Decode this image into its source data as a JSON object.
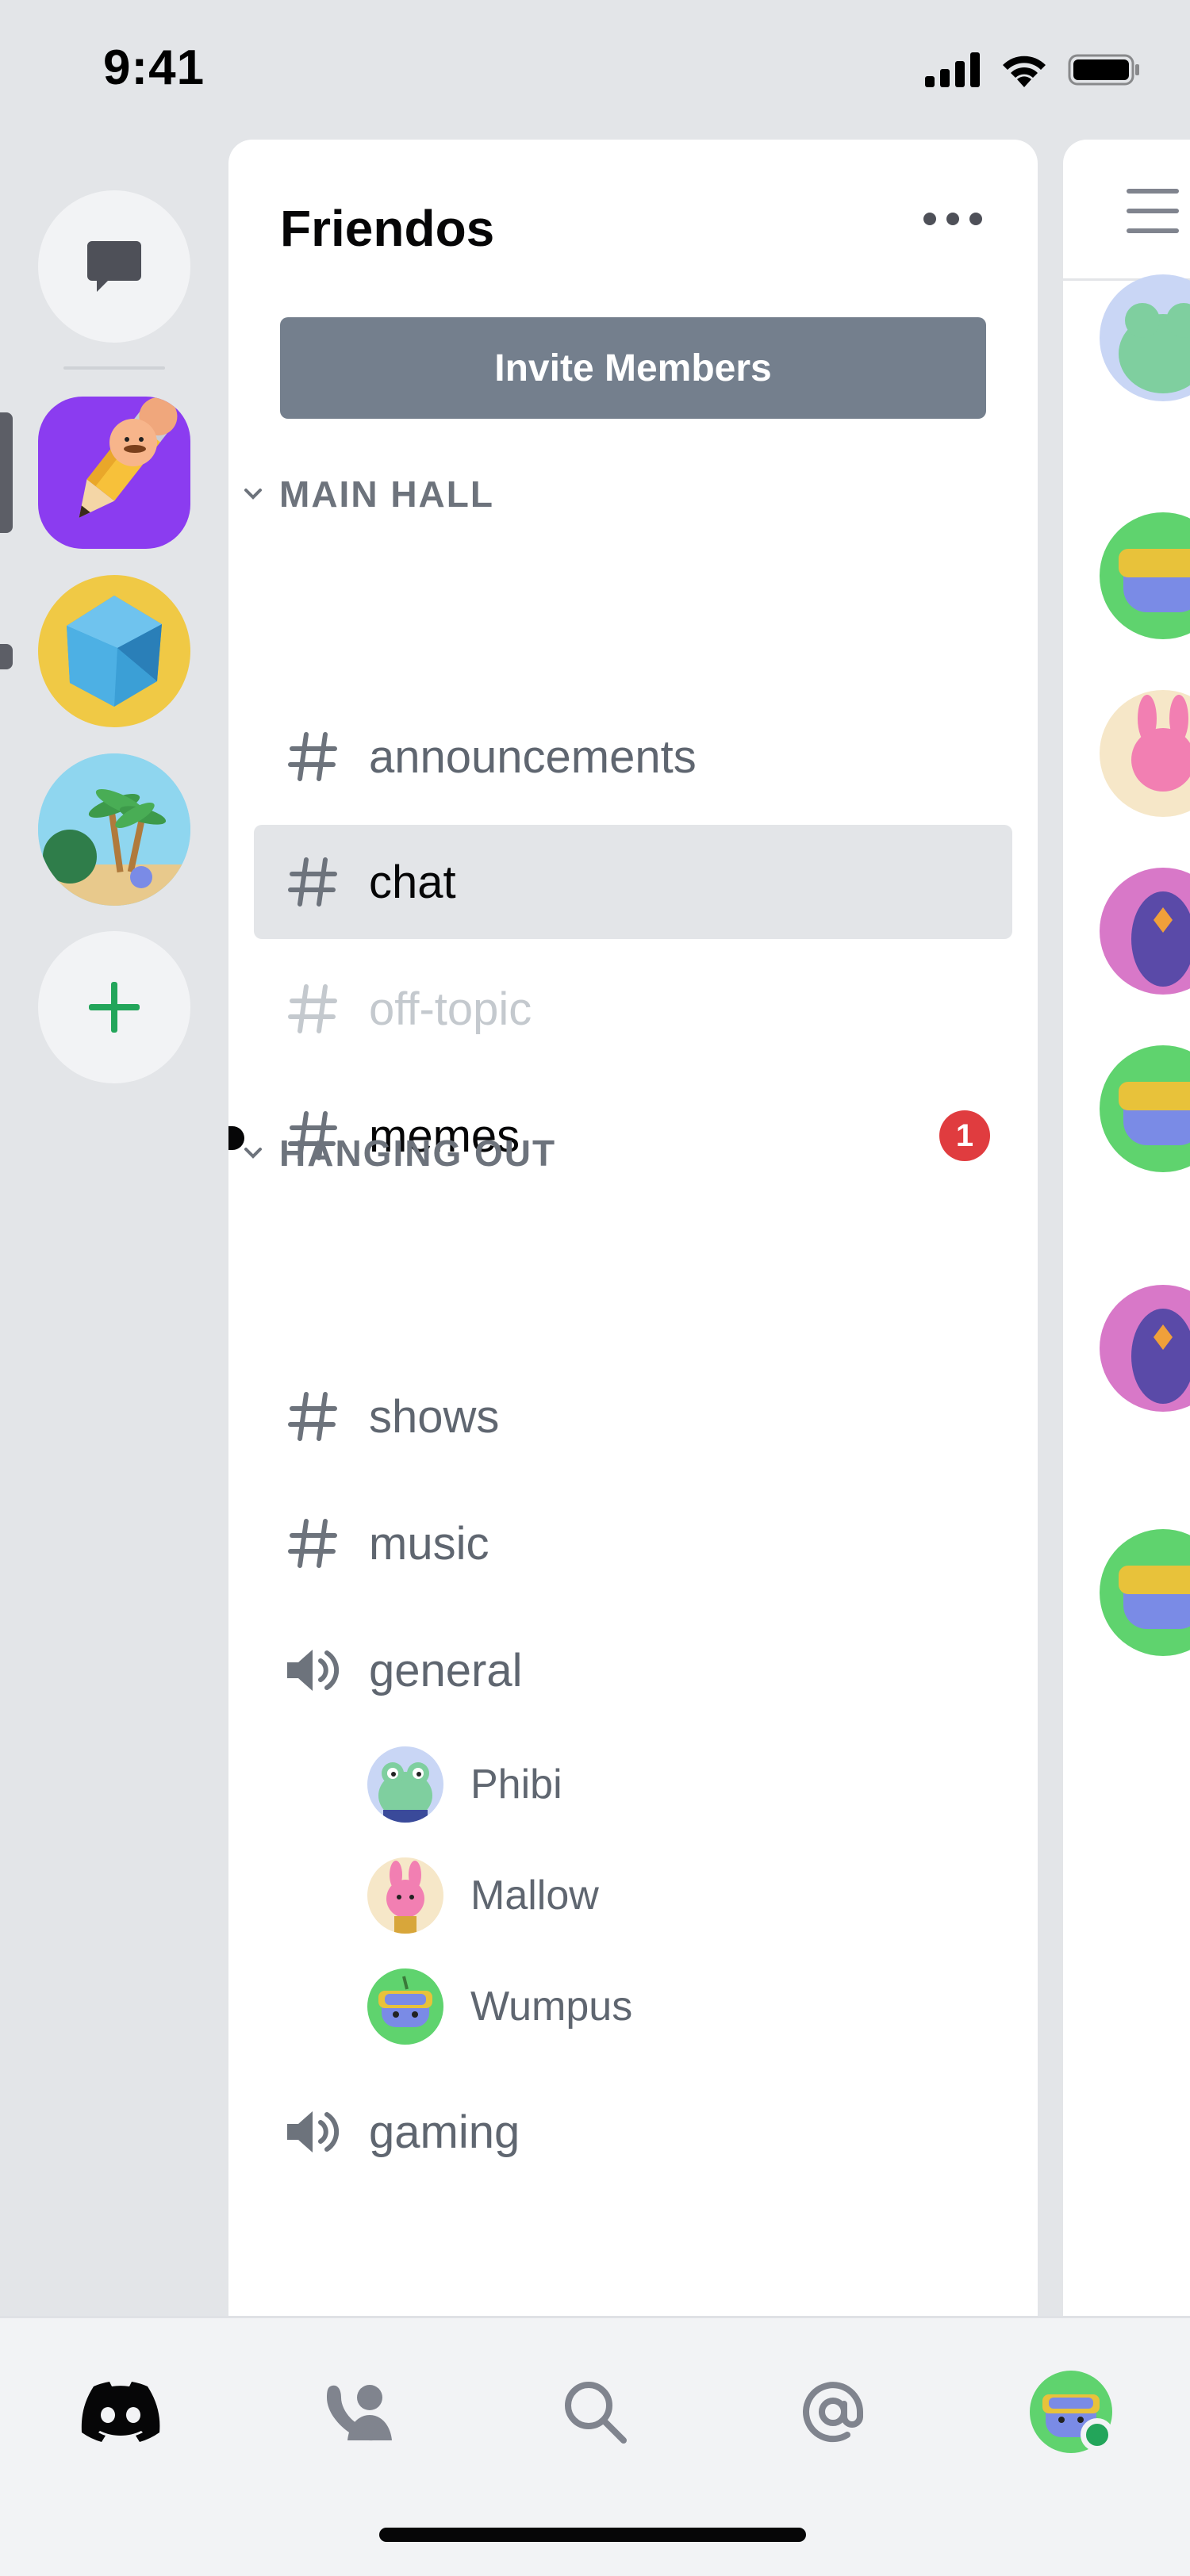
{
  "status_bar": {
    "time": "9:41",
    "icons": [
      "signal-icon",
      "wifi-icon",
      "battery-icon"
    ]
  },
  "server_rail": {
    "items": [
      {
        "name": "direct-messages",
        "icon": "chat-bubble-icon"
      },
      {
        "name": "server-pencil",
        "icon": "pencil-mascot-icon",
        "selected": true
      },
      {
        "name": "server-gem",
        "icon": "gem-icon",
        "unread": true
      },
      {
        "name": "server-island",
        "icon": "island-icon"
      },
      {
        "name": "add-server",
        "icon": "plus-icon"
      }
    ]
  },
  "server": {
    "title": "Friendos",
    "invite_label": "Invite Members"
  },
  "categories": {
    "main_hall": "MAIN HALL",
    "hanging_out": "HANGING OUT"
  },
  "channels": {
    "announcements": "announcements",
    "chat": "chat",
    "off_topic": "off-topic",
    "memes": "memes",
    "memes_badge": "1",
    "shows": "shows",
    "music": "music",
    "general": "general",
    "gaming": "gaming"
  },
  "voice_users": {
    "phibi": "Phibi",
    "mallow": "Mallow",
    "wumpus": "Wumpus"
  },
  "bottom_nav": {
    "items": [
      "home-icon",
      "friends-icon",
      "search-icon",
      "mentions-icon",
      "profile-avatar"
    ]
  },
  "colors": {
    "background": "#e3e5e8",
    "panel": "#ffffff",
    "invite_button": "#747f8d",
    "selected_channel": "#e3e5e8",
    "badge": "#e03c3f",
    "online": "#23a55a",
    "add_server_plus": "#23a55a"
  }
}
